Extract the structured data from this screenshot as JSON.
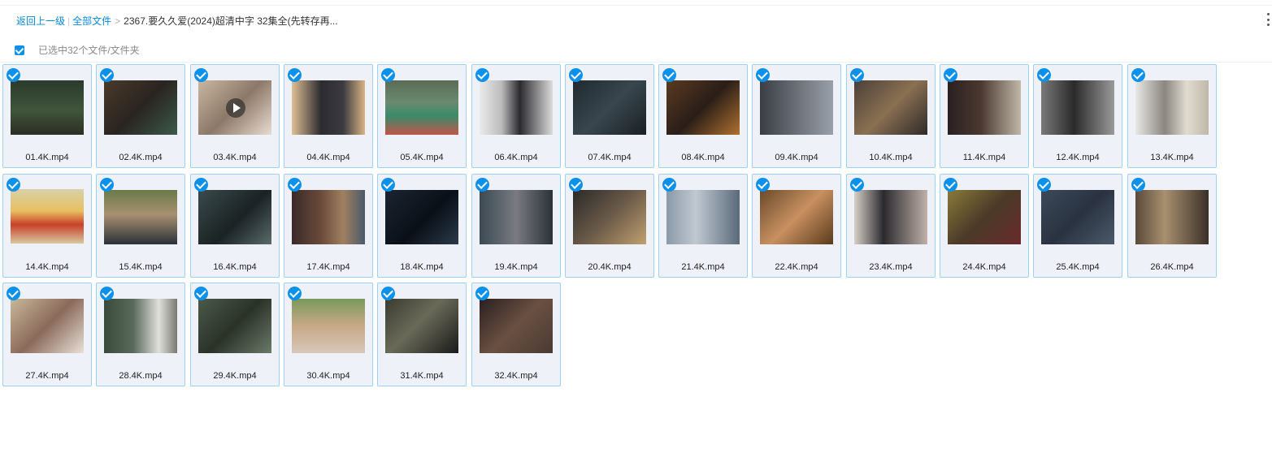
{
  "breadcrumb": {
    "back": "返回上一级",
    "all_files": "全部文件",
    "separator": ">",
    "current": "2367.要久久爱(2024)超清中字 32集全(先转存再..."
  },
  "selection": {
    "label": "已选中32个文件/文件夹"
  },
  "files": [
    {
      "name": "01.4K.mp4",
      "bg": "linear-gradient(180deg,#2b3a2c 0%,#40553b 55%,#2c2e24 100%)"
    },
    {
      "name": "02.4K.mp4",
      "bg": "linear-gradient(135deg,#4a3a2a 0%,#2a2420 50%,#3b5a4a 100%)"
    },
    {
      "name": "03.4K.mp4",
      "bg": "linear-gradient(135deg,#c9b7a2 0%,#8c7868 50%,#e8dcd0 100%)",
      "play": true
    },
    {
      "name": "04.4K.mp4",
      "bg": "linear-gradient(90deg,#e0c095 0%,#2b2b30 40%,#3a3a40 70%,#d9b485 100%)"
    },
    {
      "name": "05.4K.mp4",
      "bg": "linear-gradient(180deg,#5b6b55 0%,#6a8a70 40%,#3a8a6a 65%,#c0554b 100%)"
    },
    {
      "name": "06.4K.mp4",
      "bg": "linear-gradient(90deg,#eaeaea 0%,#bcbcbc 30%,#2a2a2e 55%,#dcdcdc 100%)"
    },
    {
      "name": "07.4K.mp4",
      "bg": "linear-gradient(135deg,#1f2a30 0%,#38464e 50%,#1a2024 100%)"
    },
    {
      "name": "08.4K.mp4",
      "bg": "linear-gradient(135deg,#5a3a20 0%,#2a1e18 50%,#b07030 100%)"
    },
    {
      "name": "09.4K.mp4",
      "bg": "linear-gradient(90deg,#3a3e44 0%,#6a6f78 50%,#9aa0aa 100%)"
    },
    {
      "name": "10.4K.mp4",
      "bg": "linear-gradient(135deg,#4a4038 0%,#8a7052 50%,#2e2a28 100%)"
    },
    {
      "name": "11.4K.mp4",
      "bg": "linear-gradient(90deg,#2a2020 0%,#4a3830 45%,#c0b8a8 100%)"
    },
    {
      "name": "12.4K.mp4",
      "bg": "linear-gradient(90deg,#7a7a7a 0%,#2a2a2a 45%,#9a9a9a 100%)"
    },
    {
      "name": "13.4K.mp4",
      "bg": "linear-gradient(90deg,#e8e8e4 0%,#8a8680 40%,#e0dcd0 70%,#c0b8a8 100%)"
    },
    {
      "name": "14.4K.mp4",
      "bg": "linear-gradient(180deg,#d8d0a8 0%,#e8c060 40%,#c8402a 65%,#d8c8a0 100%)"
    },
    {
      "name": "15.4K.mp4",
      "bg": "linear-gradient(180deg,#6a7a4a 0%,#a89070 45%,#2a3038 100%)"
    },
    {
      "name": "16.4K.mp4",
      "bg": "linear-gradient(135deg,#3a4a4a 0%,#1a2224 55%,#5a6a6a 100%)"
    },
    {
      "name": "17.4K.mp4",
      "bg": "linear-gradient(90deg,#3a2a28 0%,#6a4a3a 40%,#a08060 70%,#4a5a6a 100%)"
    },
    {
      "name": "18.4K.mp4",
      "bg": "linear-gradient(135deg,#1a2430 0%,#0a1018 55%,#2a3a4a 100%)"
    },
    {
      "name": "19.4K.mp4",
      "bg": "linear-gradient(90deg,#3a4a54 0%,#7a7a80 50%,#2a3238 100%)"
    },
    {
      "name": "20.4K.mp4",
      "bg": "linear-gradient(135deg,#2a2a28 0%,#6a5a48 50%,#c0a070 100%)"
    },
    {
      "name": "21.4K.mp4",
      "bg": "linear-gradient(90deg,#8a9aa8 0%,#c0c8d0 40%,#5a6a7a 100%)"
    },
    {
      "name": "22.4K.mp4",
      "bg": "linear-gradient(135deg,#6a4a2a 0%,#c89060 50%,#5a3a1a 100%)"
    },
    {
      "name": "23.4K.mp4",
      "bg": "linear-gradient(90deg,#d8d0c8 0%,#2a2a2e 40%,#c0b0a8 100%)"
    },
    {
      "name": "24.4K.mp4",
      "bg": "linear-gradient(135deg,#8a7a3a 0%,#4a3a28 50%,#6a2a2a 100%)"
    },
    {
      "name": "25.4K.mp4",
      "bg": "linear-gradient(135deg,#3a4a5a 0%,#2a3240 50%,#4a5a6a 100%)"
    },
    {
      "name": "26.4K.mp4",
      "bg": "linear-gradient(90deg,#5a4a3a 0%,#a89070 40%,#3a3028 100%)"
    },
    {
      "name": "27.4K.mp4",
      "bg": "linear-gradient(135deg,#c8b898 0%,#8a6a5a 50%,#e8e0d8 100%)"
    },
    {
      "name": "28.4K.mp4",
      "bg": "linear-gradient(90deg,#3a4a3a 0%,#5a6a5a 40%,#e0e0dc 75%,#7a7a70 100%)"
    },
    {
      "name": "29.4K.mp4",
      "bg": "linear-gradient(135deg,#4a5a4a 0%,#2a3228 50%,#6a7a68 100%)"
    },
    {
      "name": "30.4K.mp4",
      "bg": "linear-gradient(180deg,#7a9a5a 0%,#c8a888 50%,#d8c8b8 100%)"
    },
    {
      "name": "31.4K.mp4",
      "bg": "linear-gradient(135deg,#3a3a30 0%,#6a6a58 45%,#1a1a1a 100%)"
    },
    {
      "name": "32.4K.mp4",
      "bg": "linear-gradient(135deg,#2a2020 0%,#6a5040 50%,#4a3a34 100%)"
    }
  ]
}
